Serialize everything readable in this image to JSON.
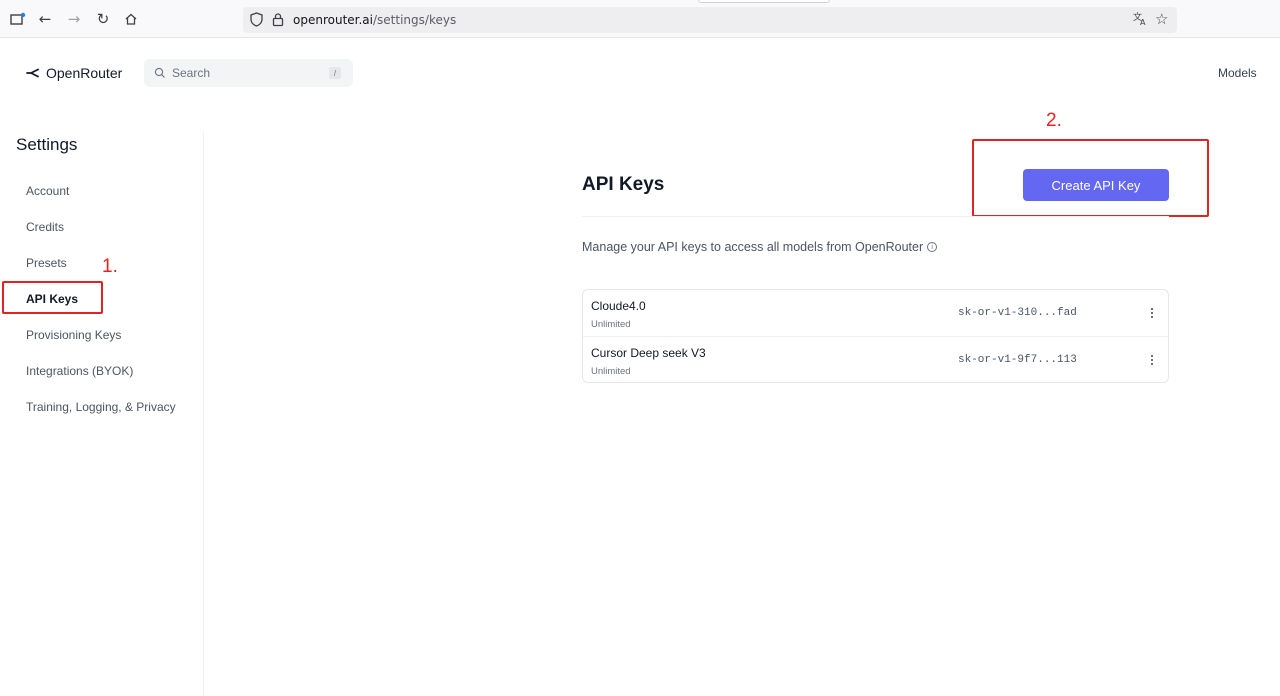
{
  "browser": {
    "url_host": "openrouter.ai",
    "url_path": "/settings/keys"
  },
  "nav": {
    "logo_text": "OpenRouter",
    "search_placeholder": "Search",
    "search_shortcut": "/",
    "models_label": "Models"
  },
  "sidebar": {
    "title": "Settings",
    "items": [
      {
        "label": "Account"
      },
      {
        "label": "Credits"
      },
      {
        "label": "Presets"
      },
      {
        "label": "API Keys",
        "active": true
      },
      {
        "label": "Provisioning Keys"
      },
      {
        "label": "Integrations (BYOK)"
      },
      {
        "label": "Training, Logging, & Privacy"
      }
    ]
  },
  "annotations": {
    "step1": "1.",
    "step2": "2."
  },
  "main": {
    "title": "API Keys",
    "create_button": "Create API Key",
    "description": "Manage your API keys to access all models from OpenRouter",
    "keys": [
      {
        "name": "Cloude4.0",
        "limit": "Unlimited",
        "key": "sk-or-v1-310...fad"
      },
      {
        "name": "Cursor Deep seek V3",
        "limit": "Unlimited",
        "key": "sk-or-v1-9f7...113"
      }
    ]
  },
  "colors": {
    "accent": "#6467f2",
    "annotation": "#e02424"
  }
}
